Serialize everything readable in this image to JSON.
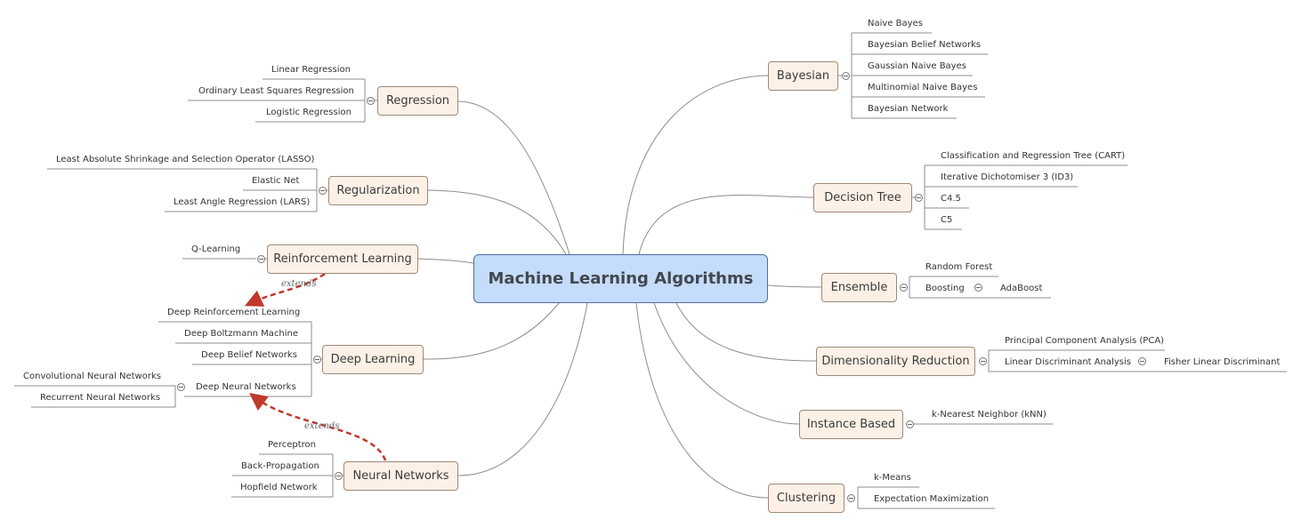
{
  "central": {
    "label": "Machine Learning Algorithms"
  },
  "left_branches": [
    {
      "label": "Regression",
      "children": [
        "Linear Regression",
        "Ordinary Least Squares Regression",
        "Logistic Regression"
      ]
    },
    {
      "label": "Regularization",
      "children": [
        "Least Absolute Shrinkage and Selection Operator (LASSO)",
        "Elastic Net",
        "Least Angle Regression (LARS)"
      ]
    },
    {
      "label": "Reinforcement Learning",
      "children": [
        "Q-Learning"
      ]
    },
    {
      "label": "Deep Learning",
      "children": [
        "Deep Reinforcement Learning",
        "Deep Boltzmann Machine",
        "Deep Belief Networks",
        "Deep Neural Networks"
      ],
      "grandchildren": {
        "Deep Neural Networks": [
          "Convolutional Neural Networks",
          "Recurrent Neural Networks"
        ]
      }
    },
    {
      "label": "Neural Networks",
      "children": [
        "Perceptron",
        "Back-Propagation",
        "Hopfield Network"
      ]
    }
  ],
  "right_branches": [
    {
      "label": "Bayesian",
      "children": [
        "Naive Bayes",
        "Bayesian Belief Networks",
        "Gaussian Naive Bayes",
        "Multinomial Naive Bayes",
        "Bayesian Network"
      ]
    },
    {
      "label": "Decision Tree",
      "children": [
        "Classification and Regression Tree (CART)",
        "Iterative Dichotomiser 3 (ID3)",
        "C4.5",
        "C5"
      ]
    },
    {
      "label": "Ensemble",
      "children": [
        "Random Forest",
        "Boosting"
      ],
      "grandchildren": {
        "Boosting": [
          "AdaBoost"
        ]
      }
    },
    {
      "label": "Dimensionality Reduction",
      "children": [
        "Principal Component Analysis (PCA)",
        "Linear Discriminant Analysis"
      ],
      "grandchildren": {
        "Linear Discriminant Analysis": [
          "Fisher Linear Discriminant"
        ]
      }
    },
    {
      "label": "Instance Based",
      "children": [
        "k-Nearest Neighbor (kNN)"
      ]
    },
    {
      "label": "Clustering",
      "children": [
        "k-Means",
        "Expectation Maximization"
      ]
    }
  ],
  "relationships": [
    {
      "from": "Reinforcement Learning",
      "to": "Deep Reinforcement Learning",
      "label": "extends"
    },
    {
      "from": "Neural Networks",
      "to": "Deep Neural Networks",
      "label": "extends"
    }
  ],
  "colors": {
    "topic_fill": "#fdf1e7",
    "topic_border": "#a08878",
    "central_fill": "#c5dcfb",
    "central_border": "#4c6d9c",
    "relationship": "#c0392b",
    "connector": "#888888"
  }
}
